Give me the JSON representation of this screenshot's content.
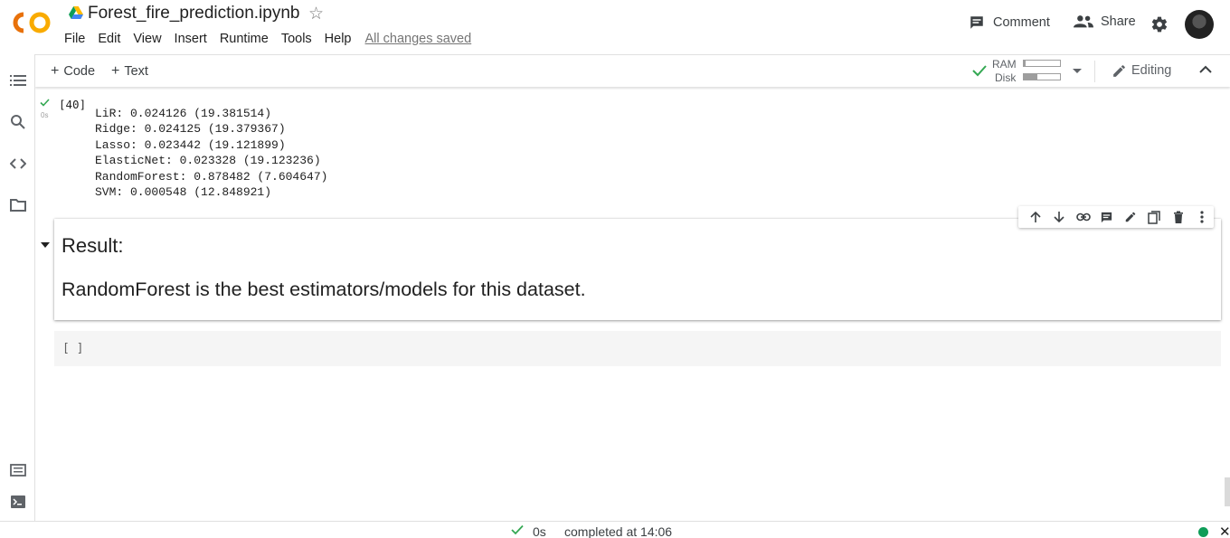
{
  "app": {
    "logo_text": "CO",
    "notebook_title": "Forest_fire_prediction.ipynb",
    "menu": [
      "File",
      "Edit",
      "View",
      "Insert",
      "Runtime",
      "Tools",
      "Help"
    ],
    "save_status": "All changes saved",
    "comment_label": "Comment",
    "share_label": "Share"
  },
  "toolbar": {
    "add_code": "Code",
    "add_text": "Text",
    "ram_label": "RAM",
    "disk_label": "Disk",
    "ram_usage": 0.05,
    "disk_usage": 0.38,
    "editing_label": "Editing"
  },
  "output_cell": {
    "exec_count": "[40]",
    "run_time": "0s",
    "lines": [
      "LiR: 0.024126 (19.381514)",
      "Ridge: 0.024125 (19.379367)",
      "Lasso: 0.023442 (19.121899)",
      "ElasticNet: 0.023328 (19.123236)",
      "RandomForest: 0.878482 (7.604647)",
      "SVM: 0.000548 (12.848921)"
    ]
  },
  "text_cell": {
    "heading": "Result:",
    "body": "RandomForest is the best estimators/models for this dataset."
  },
  "empty_cell": {
    "bracket": "[ ]"
  },
  "status_bar": {
    "duration": "0s",
    "message": "completed at 14:06"
  },
  "colors": {
    "logo_orange": "#F9AB00",
    "logo_dark_orange": "#E8710A",
    "success_green": "#0F9D58",
    "check_green": "#34A853"
  }
}
